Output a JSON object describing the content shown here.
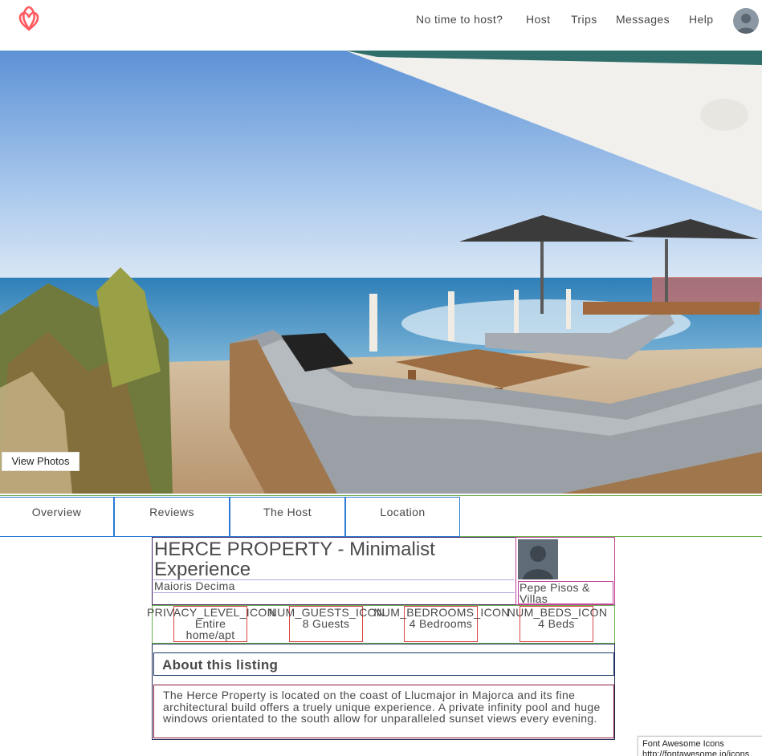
{
  "header": {
    "logo_icon": "airbnb-logo-icon",
    "brand_color": "#ff5a5f",
    "nav": [
      {
        "label": "No time to host?"
      },
      {
        "label": "Host"
      },
      {
        "label": "Trips"
      },
      {
        "label": "Messages"
      },
      {
        "label": "Help"
      }
    ],
    "avatar_icon": "user-avatar-icon"
  },
  "hero": {
    "view_photos_label": "View Photos"
  },
  "tabs": [
    {
      "label": "Overview"
    },
    {
      "label": "Reviews"
    },
    {
      "label": "The Host"
    },
    {
      "label": "Location"
    }
  ],
  "listing": {
    "title": "HERCE PROPERTY - Minimalist Experience",
    "location": "Maioris Decima",
    "host_name": "Pepe Pisos & Villas",
    "features": [
      {
        "icon": "PRIVACY_LEVEL_ICON",
        "value": "Entire home/apt"
      },
      {
        "icon": "NUM_GUESTS_ICON",
        "value": "8 Guests"
      },
      {
        "icon": "NUM_BEDROOMS_ICON",
        "value": "4 Bedrooms"
      },
      {
        "icon": "NUM_BEDS_ICON",
        "value": "4 Beds"
      }
    ],
    "about_heading": "About this listing",
    "about_text": "The Herce Property is located on the coast of Llucmajor in Majorca and its fine architectural build offers a truely unique experience. A private infinity pool and huge windows orientated to the south allow for unparalleled sunset views every evening."
  },
  "footer_note": {
    "line1": "Font Awesome Icons",
    "line2": "http://fontawesome.io/icons"
  }
}
